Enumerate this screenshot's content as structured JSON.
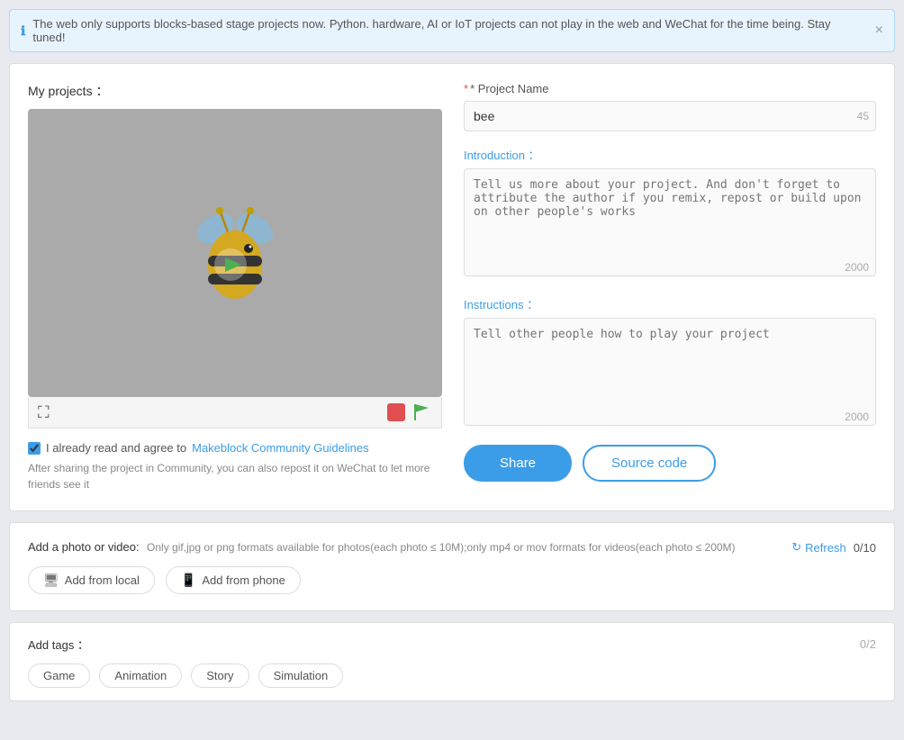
{
  "notice": {
    "icon": "ℹ",
    "text": "The web only supports blocks-based stage projects now. Python. hardware, AI or IoT projects can not play in the web and WeChat for the time being. Stay tuned!",
    "close": "×"
  },
  "my_projects": {
    "label": "My projects ："
  },
  "project_name": {
    "label": "* Project Name",
    "value": "bee",
    "char_count": "45"
  },
  "introduction": {
    "label": "Introduction ：",
    "placeholder": "Tell us more about your project. And don't forget to attribute the author if you remix, repost or build upon on other people's works",
    "char_count": "2000"
  },
  "instructions": {
    "label": "Instructions ：",
    "placeholder": "Tell other people how to play your project",
    "char_count": "2000"
  },
  "agree": {
    "label": "I already read and agree to ",
    "link_text": "Makeblock Community Guidelines",
    "desc": "After sharing the project in Community, you can also repost it on WeChat to let more friends see it"
  },
  "buttons": {
    "share": "Share",
    "source_code": "Source code"
  },
  "media": {
    "add_photo_label": "Add a photo or video:",
    "add_photo_desc": "Only gif,jpg or png formats available for photos(each photo ≤ 10M);only mp4 or mov formats for videos(each photo ≤ 200M)",
    "refresh": "Refresh",
    "ratio": "0/10",
    "add_local": "Add from local",
    "add_phone": "Add from phone"
  },
  "tags": {
    "label": "Add tags ：",
    "ratio": "0/2",
    "items": [
      "Game",
      "Animation",
      "Story",
      "Simulation"
    ]
  }
}
